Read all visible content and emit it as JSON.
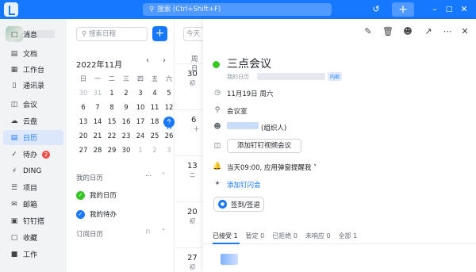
{
  "topbar": {
    "search_placeholder": "搜索 (Ctrl+Shift+F)",
    "icons": [
      "history-icon",
      "add-icon",
      "minimize-icon",
      "maximize-icon",
      "close-icon"
    ]
  },
  "sidebar": {
    "items": [
      {
        "label": "消息",
        "icon": "message-icon"
      },
      {
        "label": "文档",
        "icon": "docs-icon"
      },
      {
        "label": "工作台",
        "icon": "workbench-icon"
      },
      {
        "label": "通讯录",
        "icon": "contacts-icon"
      },
      {
        "label": "会议",
        "icon": "meeting-icon"
      },
      {
        "label": "云盘",
        "icon": "cloud-icon"
      },
      {
        "label": "日历",
        "icon": "calendar-icon",
        "active": true
      },
      {
        "label": "待办",
        "icon": "todo-icon",
        "badge": "2"
      },
      {
        "label": "DING",
        "icon": "ding-icon"
      },
      {
        "label": "项目",
        "icon": "project-icon"
      },
      {
        "label": "邮箱",
        "icon": "mail-icon"
      },
      {
        "label": "钉钉搭",
        "icon": "builder-icon"
      },
      {
        "label": "收藏",
        "icon": "favorite-icon"
      },
      {
        "label": "工作",
        "icon": "work-icon"
      }
    ]
  },
  "calendar": {
    "search_placeholder": "搜索日程",
    "month_label": "2022年11月",
    "weekdays": [
      "日",
      "一",
      "二",
      "三",
      "四",
      "五",
      "六"
    ],
    "weeks": [
      [
        {
          "d": "30",
          "m": true
        },
        {
          "d": "31",
          "m": true
        },
        {
          "d": "1"
        },
        {
          "d": "2"
        },
        {
          "d": "3"
        },
        {
          "d": "4"
        },
        {
          "d": "5"
        }
      ],
      [
        {
          "d": "6"
        },
        {
          "d": "7"
        },
        {
          "d": "8"
        },
        {
          "d": "9"
        },
        {
          "d": "10"
        },
        {
          "d": "11"
        },
        {
          "d": "12"
        }
      ],
      [
        {
          "d": "13"
        },
        {
          "d": "14"
        },
        {
          "d": "15"
        },
        {
          "d": "16"
        },
        {
          "d": "17"
        },
        {
          "d": "18"
        },
        {
          "d": "19"
        }
      ],
      [
        {
          "d": "20"
        },
        {
          "d": "21"
        },
        {
          "d": "22"
        },
        {
          "d": "23"
        },
        {
          "d": "24"
        },
        {
          "d": "25"
        },
        {
          "d": "26"
        }
      ],
      [
        {
          "d": "27"
        },
        {
          "d": "28"
        },
        {
          "d": "29"
        },
        {
          "d": "30"
        },
        {
          "d": "1",
          "m": true
        },
        {
          "d": "2",
          "m": true
        },
        {
          "d": "3",
          "m": true
        }
      ]
    ],
    "today_label": "今",
    "my_calendars_title": "我的日历",
    "my_calendars": [
      {
        "label": "我的日历",
        "color": "#34c724"
      },
      {
        "label": "我的待办",
        "color": "#1677ff"
      }
    ],
    "subscribed_title": "订阅日历"
  },
  "week": {
    "search_placeholder": "今天",
    "header": "周日",
    "days": [
      {
        "num": "30",
        "sub": "初"
      },
      {
        "num": "6",
        "sub": "十"
      },
      {
        "num": "13",
        "sub": "二"
      },
      {
        "num": "20",
        "sub": "初"
      },
      {
        "num": "27",
        "sub": "初"
      }
    ]
  },
  "detail": {
    "title": "三点会议",
    "owner": "我的日历",
    "tag": "内部",
    "date": "11月19日 周六",
    "location": "会议室",
    "organizer_suffix": "(组织人)",
    "video_button": "添加钉钉视频会议",
    "reminder": "当天09:00, 应用弹窗提醒我",
    "flash_link": "添加钉闪会",
    "checkin_button": "签到/签退",
    "tabs": [
      "已接受 1",
      "暂定 0",
      "已拒绝 0",
      "未响应 0",
      "全部 1"
    ],
    "status_color": "#34c724"
  }
}
